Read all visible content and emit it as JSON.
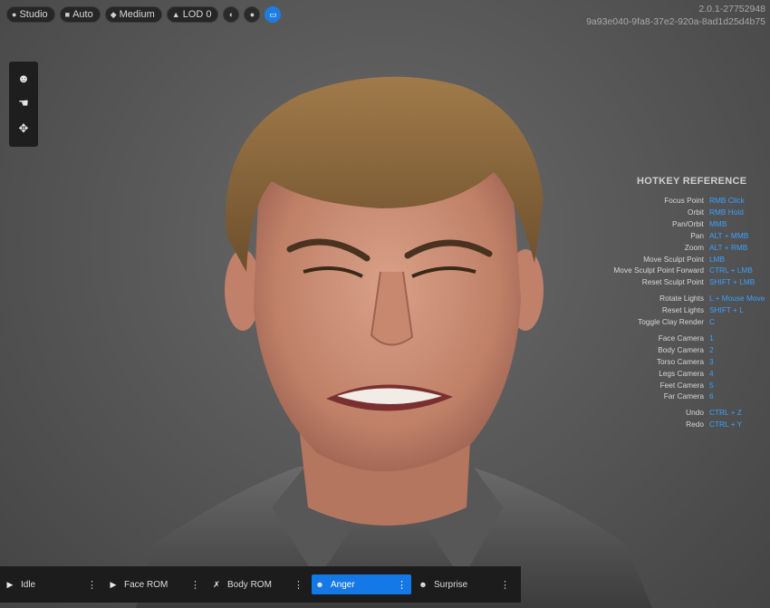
{
  "toolbar": {
    "pills": [
      {
        "icon": "light-bulb-icon",
        "glyph": "●",
        "label": "Studio"
      },
      {
        "icon": "camera-icon",
        "glyph": "■",
        "label": "Auto"
      },
      {
        "icon": "diamond-icon",
        "glyph": "◆",
        "label": "Medium"
      },
      {
        "icon": "lod-icon",
        "glyph": "▲",
        "label": "LOD 0"
      }
    ],
    "round_buttons": [
      {
        "icon": "clay-render-icon",
        "glyph": "◐"
      },
      {
        "icon": "sphere-icon",
        "glyph": "●"
      },
      {
        "icon": "display-icon",
        "glyph": "▭",
        "active": true
      }
    ]
  },
  "version": {
    "number": "2.0.1-27752948",
    "hash": "9a93e040-9fa8-37e2-920a-8ad1d25d4b75"
  },
  "left_tools": [
    {
      "icon": "head-icon",
      "glyph": "☻"
    },
    {
      "icon": "sculpt-hand-icon",
      "glyph": "☚"
    },
    {
      "icon": "move-icon",
      "glyph": "✥"
    }
  ],
  "hotkeys": {
    "title": "HOTKEY REFERENCE",
    "rows": [
      {
        "action": "Focus Point",
        "key": "RMB Click"
      },
      {
        "action": "Orbit",
        "key": "RMB Hold"
      },
      {
        "action": "Pan/Orbit",
        "key": "MMB"
      },
      {
        "action": "Pan",
        "key": "ALT + MMB"
      },
      {
        "action": "Zoom",
        "key": "ALT + RMB"
      },
      {
        "action": "Move Sculpt Point",
        "key": "LMB"
      },
      {
        "action": "Move Sculpt Point Forward",
        "key": "CTRL + LMB"
      },
      {
        "action": "Reset Sculpt Point",
        "key": "SHIFT + LMB"
      },
      {
        "action": "Rotate Lights",
        "key": "L + Mouse Move"
      },
      {
        "action": "Reset Lights",
        "key": "SHIFT + L"
      },
      {
        "action": "Toggle Clay Render",
        "key": "C"
      },
      {
        "action": "Face Camera",
        "key": "1"
      },
      {
        "action": "Body Camera",
        "key": "2"
      },
      {
        "action": "Torso Camera",
        "key": "3"
      },
      {
        "action": "Legs Camera",
        "key": "4"
      },
      {
        "action": "Feet Camera",
        "key": "5"
      },
      {
        "action": "Far Camera",
        "key": "6"
      },
      {
        "action": "Undo",
        "key": "CTRL + Z"
      },
      {
        "action": "Redo",
        "key": "CTRL + Y"
      }
    ]
  },
  "animations": [
    {
      "icon": "play-icon",
      "glyph": "▶",
      "label": "Idle"
    },
    {
      "icon": "play-icon",
      "glyph": "▶",
      "label": "Face ROM"
    },
    {
      "icon": "running-figure-icon",
      "glyph": "✗",
      "label": "Body ROM"
    },
    {
      "icon": "face-icon",
      "glyph": "☻",
      "label": "Anger",
      "active": true
    },
    {
      "icon": "face-icon",
      "glyph": "☻",
      "label": "Surprise"
    }
  ],
  "more_glyph": "⋮",
  "colors": {
    "accent": "#1478e6",
    "hotkey_key": "#3aa0ff"
  }
}
